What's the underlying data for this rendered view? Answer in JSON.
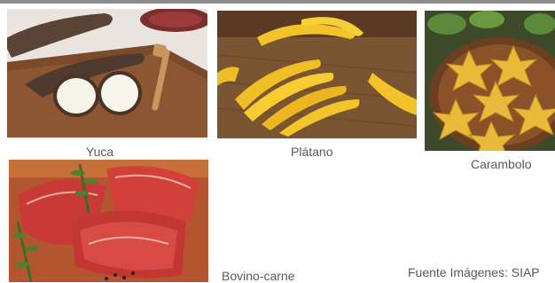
{
  "images": [
    {
      "caption": "Yuca",
      "subject": "cassava roots on wooden board"
    },
    {
      "caption": "Plátano",
      "subject": "bunch of bananas on wicker mat"
    },
    {
      "caption": "Carambolo",
      "subject": "star fruit slices in basket"
    },
    {
      "caption": "Bovino-carne",
      "subject": "raw beef cuts with rosemary"
    }
  ],
  "source": "Fuente Imágenes: SIAP",
  "colors": {
    "caption_text": "#595959",
    "top_rule": "#8c8c8c"
  }
}
